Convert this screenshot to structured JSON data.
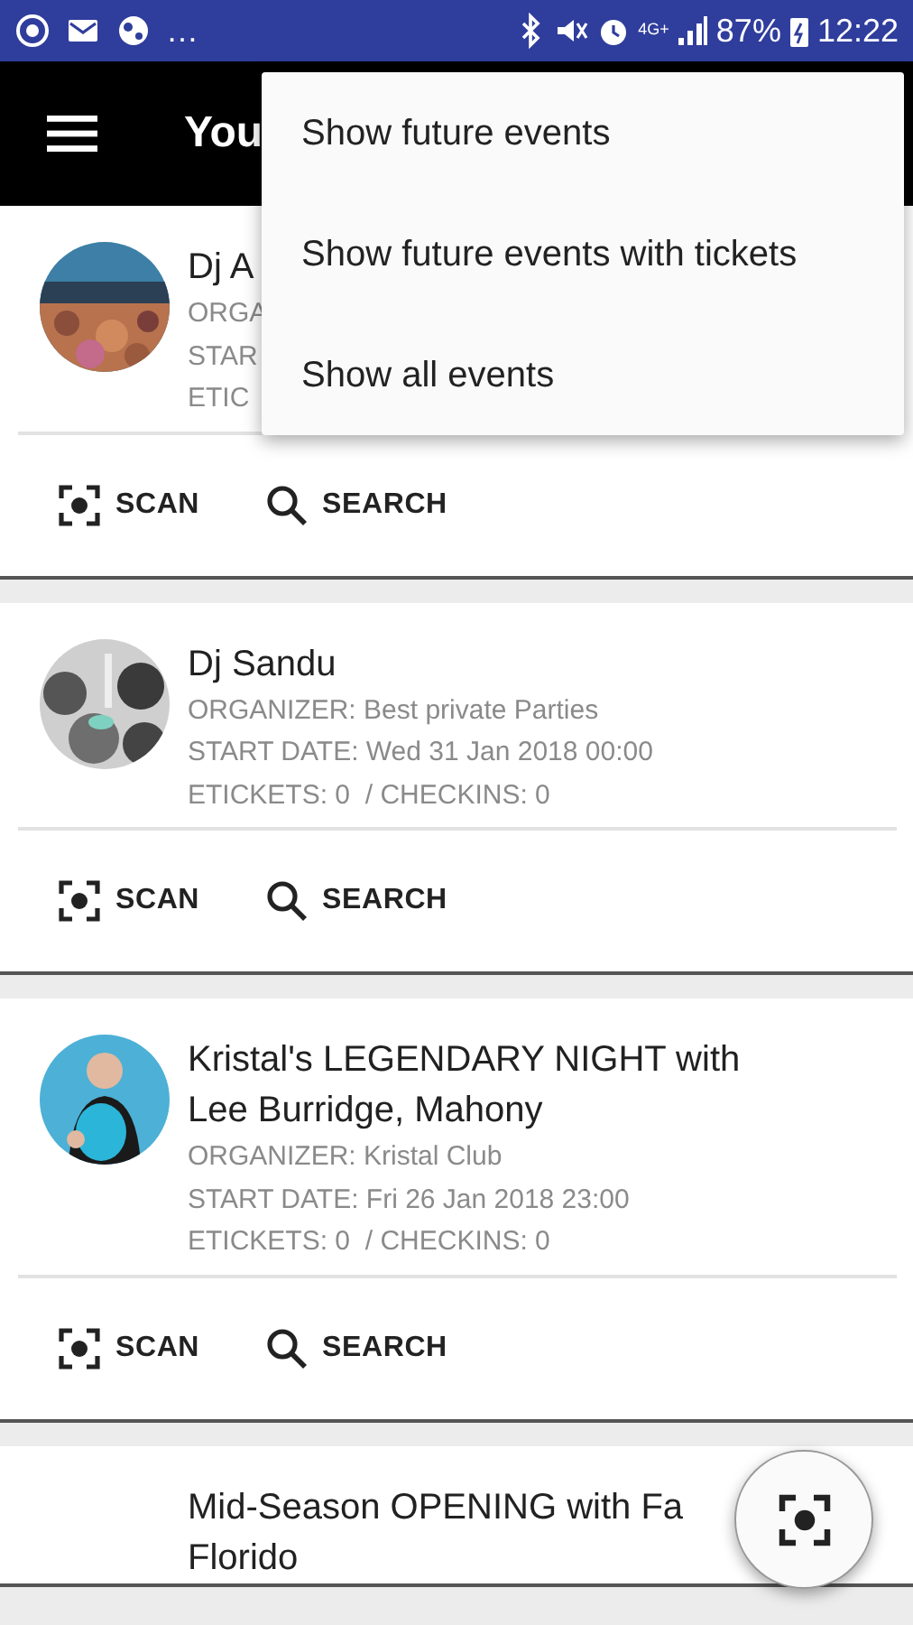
{
  "status_bar": {
    "overflow": "…",
    "network": "4G+",
    "battery": "87%",
    "time": "12:22"
  },
  "toolbar": {
    "title": "You"
  },
  "menu": {
    "items": [
      {
        "label": "Show future events"
      },
      {
        "label": "Show future events with tickets"
      },
      {
        "label": "Show all events"
      }
    ]
  },
  "events": [
    {
      "photo": true,
      "title_lines": [
        "Dj A"
      ],
      "organizer": "ORGA",
      "start": "STAR",
      "tickets": "ETIC",
      "actions": [
        "SCAN",
        "SEARCH"
      ]
    },
    {
      "photo": true,
      "title_lines": [
        "Dj Sandu"
      ],
      "organizer": "ORGANIZER: Best private Parties",
      "start": "START DATE: Wed 31 Jan 2018 00:00",
      "tickets": "ETICKETS: 0  / CHECKINS: 0",
      "actions": [
        "SCAN",
        "SEARCH"
      ]
    },
    {
      "photo": true,
      "title_lines": [
        "Kristal's LEGENDARY NIGHT with",
        "Lee Burridge, Mahony"
      ],
      "organizer": "ORGANIZER: Kristal Club",
      "start": "START DATE: Fri 26 Jan 2018 23:00",
      "tickets": "ETICKETS: 0  / CHECKINS: 0",
      "actions": [
        "SCAN",
        "SEARCH"
      ]
    },
    {
      "photo": false,
      "title_lines": [
        "Mid-Season OPENING with Fa",
        "Florido"
      ]
    }
  ],
  "fab": {
    "kind": "scan"
  }
}
